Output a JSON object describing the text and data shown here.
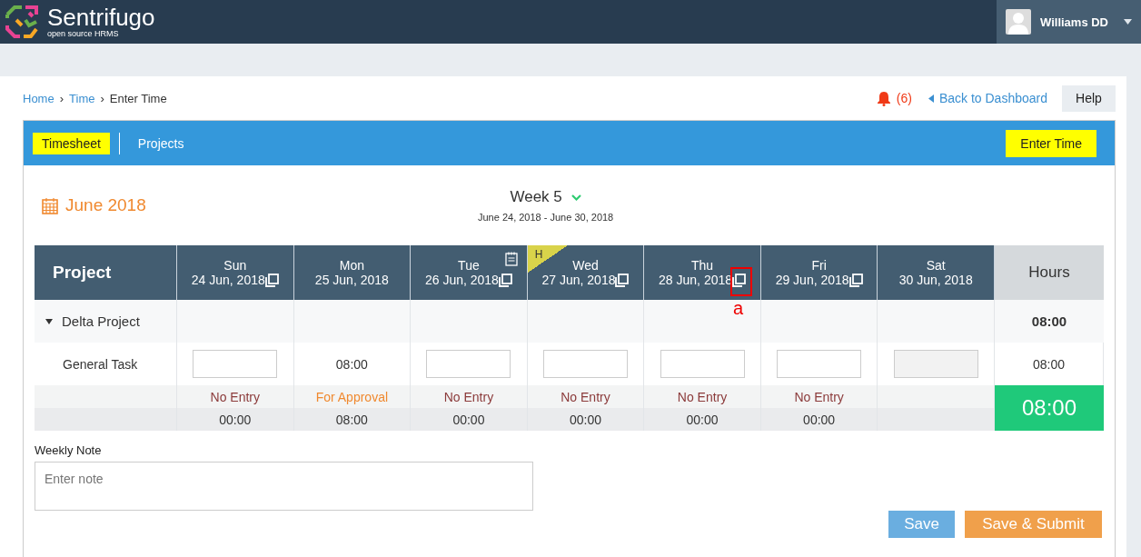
{
  "brand": {
    "name": "Sentrifugo",
    "tagline": "open source HRMS"
  },
  "user": {
    "name": "Williams DD"
  },
  "breadcrumb": [
    {
      "label": "Home",
      "kind": "link"
    },
    {
      "label": "Time",
      "kind": "link",
      "separator": "›"
    },
    {
      "label": "Enter Time",
      "kind": "current",
      "separator": "›"
    }
  ],
  "notifications": {
    "count": "(6)"
  },
  "back_link": "Back to Dashboard",
  "help_button": "Help",
  "tabs": [
    {
      "label": "Timesheet",
      "selected": true
    },
    {
      "label": "Projects",
      "selected": false
    }
  ],
  "enter_time_button": "Enter Time",
  "month": "June 2018",
  "week": {
    "title": "Week 5",
    "range": "June 24, 2018 - June 30, 2018"
  },
  "table": {
    "project_heading": "Project",
    "hours_heading": "Hours",
    "days": [
      {
        "day": "Sun",
        "date": "24 Jun, 2018",
        "copy": true,
        "note": false,
        "holiday": false
      },
      {
        "day": "Mon",
        "date": "25 Jun, 2018",
        "copy": false,
        "note": false,
        "holiday": false
      },
      {
        "day": "Tue",
        "date": "26 Jun, 2018",
        "copy": true,
        "note": true,
        "holiday": false
      },
      {
        "day": "Wed",
        "date": "27 Jun, 2018",
        "copy": true,
        "note": false,
        "holiday": true,
        "holiday_mark": "H"
      },
      {
        "day": "Thu",
        "date": "28 Jun, 2018",
        "copy": true,
        "note": false,
        "holiday": false,
        "annotation": "a"
      },
      {
        "day": "Fri",
        "date": "29 Jun, 2018",
        "copy": true,
        "note": false,
        "holiday": false
      },
      {
        "day": "Sat",
        "date": "30 Jun, 2018",
        "copy": false,
        "note": false,
        "holiday": false
      }
    ],
    "project": {
      "name": "Delta Project",
      "expanded": true,
      "total": "08:00"
    },
    "task": {
      "name": "General Task",
      "total": "08:00",
      "cells": [
        {
          "kind": "input"
        },
        {
          "kind": "value",
          "value": "08:00"
        },
        {
          "kind": "input"
        },
        {
          "kind": "input"
        },
        {
          "kind": "input"
        },
        {
          "kind": "input"
        },
        {
          "kind": "disabled"
        }
      ]
    },
    "statuses": [
      {
        "kind": "no_entry",
        "label": "No Entry"
      },
      {
        "kind": "for_approval",
        "label": "For Approval"
      },
      {
        "kind": "no_entry",
        "label": "No Entry"
      },
      {
        "kind": "no_entry",
        "label": "No Entry"
      },
      {
        "kind": "no_entry",
        "label": "No Entry"
      },
      {
        "kind": "no_entry",
        "label": "No Entry"
      },
      {
        "kind": "none"
      }
    ],
    "day_totals": [
      "00:00",
      "08:00",
      "00:00",
      "00:00",
      "00:00",
      "00:00"
    ],
    "grand_total": "08:00"
  },
  "weekly_note": {
    "label": "Weekly Note",
    "placeholder": "Enter note"
  },
  "buttons": [
    {
      "label": "Save",
      "kind": "secondary"
    },
    {
      "label": "Save & Submit",
      "kind": "primary"
    }
  ]
}
